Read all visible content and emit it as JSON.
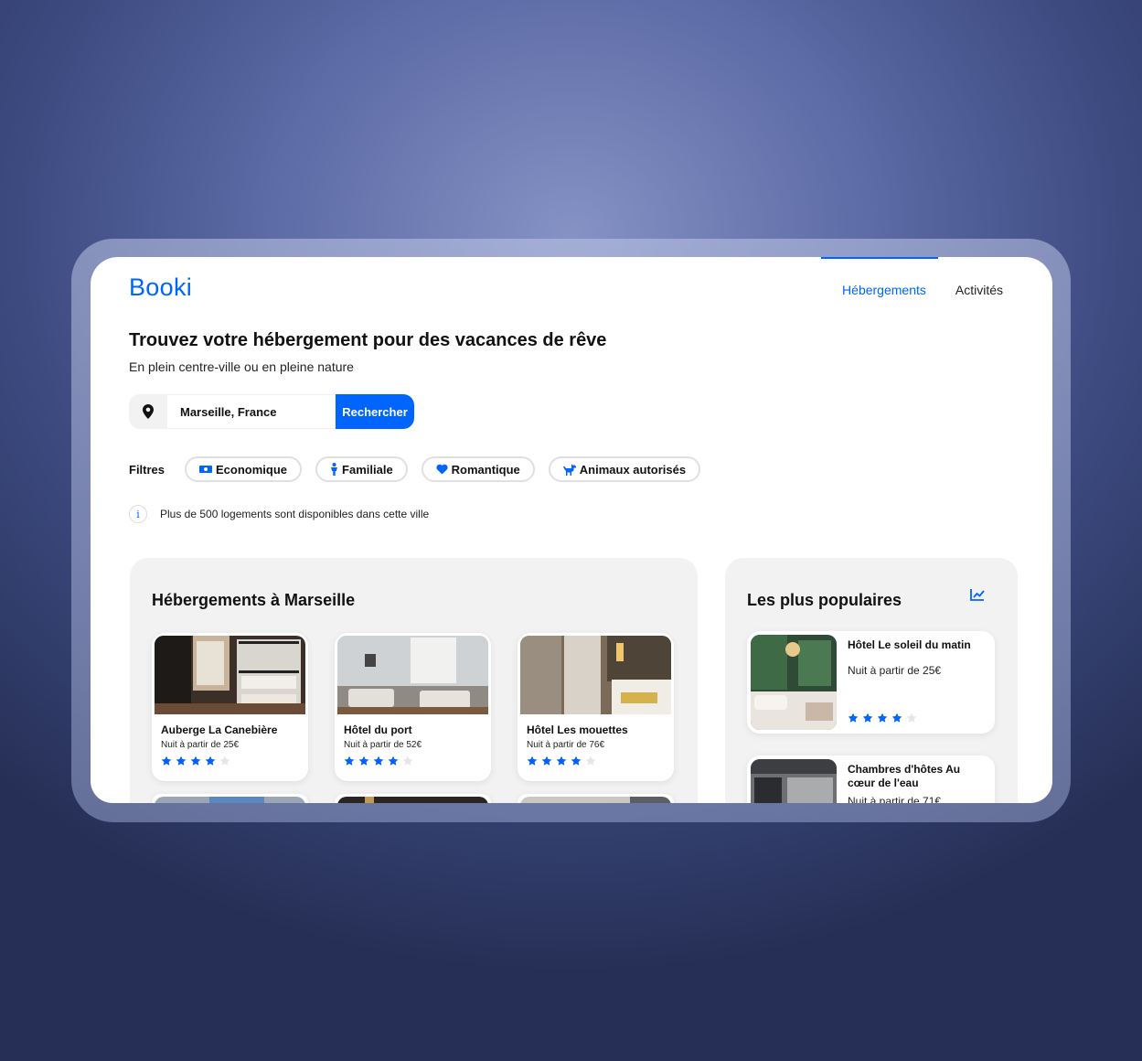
{
  "brand": {
    "logo": "Booki",
    "accent_color": "#0065fc"
  },
  "nav": {
    "items": [
      "Hébergements",
      "Activités"
    ],
    "active_index": 0
  },
  "hero": {
    "title": "Trouvez votre hébergement pour des vacances de rêve",
    "subtitle": "En plein centre-ville ou en pleine nature"
  },
  "search": {
    "icon": "location-pin-icon",
    "value": "Marseille, France",
    "button_label": "Rechercher"
  },
  "filters": {
    "label": "Filtres",
    "items": [
      {
        "label": "Economique",
        "icon": "money-icon"
      },
      {
        "label": "Familiale",
        "icon": "person-icon"
      },
      {
        "label": "Romantique",
        "icon": "heart-icon"
      },
      {
        "label": "Animaux autorisés",
        "icon": "dog-icon"
      }
    ]
  },
  "info": {
    "icon": "info-icon",
    "text": "Plus de 500 logements sont disponibles dans cette ville"
  },
  "accommodations": {
    "title": "Hébergements à Marseille",
    "cards": [
      {
        "name": "Auberge La Canebière",
        "price": "Nuit à partir de 25€",
        "rating": 4,
        "max_rating": 5
      },
      {
        "name": "Hôtel du port",
        "price": "Nuit à partir de 52€",
        "rating": 4,
        "max_rating": 5
      },
      {
        "name": "Hôtel Les mouettes",
        "price": "Nuit à partir de 76€",
        "rating": 4,
        "max_rating": 5
      }
    ]
  },
  "popular": {
    "title": "Les plus populaires",
    "icon": "trend-chart-icon",
    "cards": [
      {
        "name": "Hôtel Le soleil du matin",
        "price": "Nuit à partir de 25€",
        "rating": 4,
        "max_rating": 5
      },
      {
        "name": "Chambres d'hôtes Au cœur de l'eau",
        "price": "Nuit à partir de 71€"
      }
    ]
  }
}
